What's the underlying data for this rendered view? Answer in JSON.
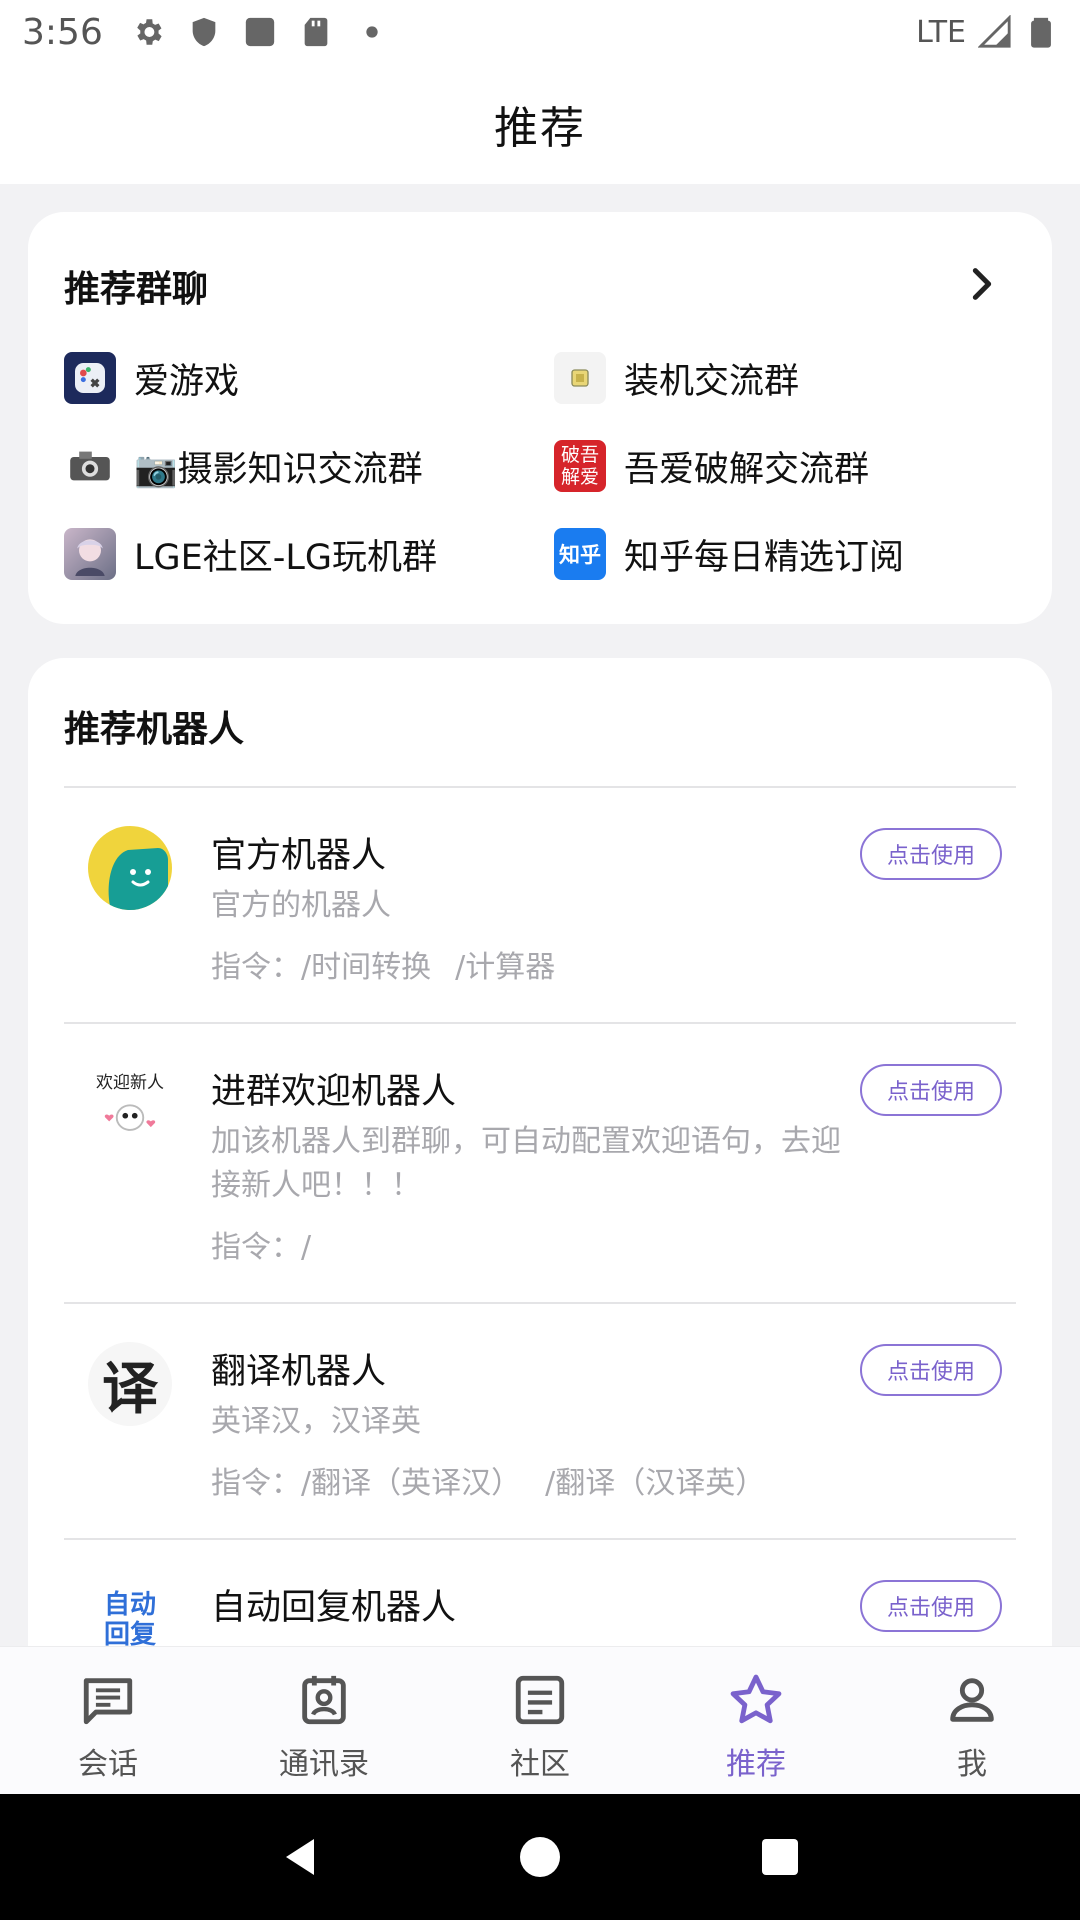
{
  "status_bar": {
    "time": "3:56",
    "network": "LTE",
    "left_icons": [
      "gear-icon",
      "shield-icon",
      "square-app-icon",
      "sd-card-icon",
      "dot-icon"
    ],
    "right_icons": [
      "signal-icon",
      "battery-icon"
    ]
  },
  "header": {
    "title": "推荐"
  },
  "groups": {
    "title": "推荐群聊",
    "items": [
      {
        "name": "爱游戏",
        "avatar": "gamepad-avatar"
      },
      {
        "name": "装机交流群",
        "avatar": "cpu-chip-avatar"
      },
      {
        "name": "📷摄影知识交流群",
        "avatar": "camera-avatar"
      },
      {
        "name": "吾爱破解交流群",
        "avatar": "seal-avatar",
        "avatar_text": "破吾解爱"
      },
      {
        "name": "LGE社区-LG玩机群",
        "avatar": "anime-avatar"
      },
      {
        "name": "知乎每日精选订阅",
        "avatar": "zhihu-avatar",
        "avatar_text": "知乎"
      }
    ]
  },
  "bots": {
    "title": "推荐机器人",
    "use_label": "点击使用",
    "items": [
      {
        "name": "官方机器人",
        "desc": "官方的机器人",
        "commands_label": "指令：",
        "commands": [
          "/时间转换",
          "/计算器"
        ],
        "avatar": "smile-bot-avatar"
      },
      {
        "name": "进群欢迎机器人",
        "desc": "加该机器人到群聊，可自动配置欢迎语句，去迎接新人吧！！！",
        "commands_label": "指令：",
        "commands": [
          "/"
        ],
        "avatar": "welcome-bot-avatar",
        "avatar_text": "欢迎新人"
      },
      {
        "name": "翻译机器人",
        "desc": "英译汉，汉译英",
        "commands_label": "指令：",
        "commands": [
          "/翻译（英译汉）",
          "/翻译（汉译英）"
        ],
        "avatar": "translate-bot-avatar",
        "avatar_text": "译"
      },
      {
        "name": "自动回复机器人",
        "desc": "",
        "commands_label": "",
        "commands": [],
        "avatar": "auto-reply-bot-avatar",
        "avatar_text": "自动回复"
      }
    ]
  },
  "bottom_nav": {
    "active": "推荐",
    "items": [
      {
        "label": "会话",
        "icon": "chat-icon"
      },
      {
        "label": "通讯录",
        "icon": "contacts-icon"
      },
      {
        "label": "社区",
        "icon": "community-icon"
      },
      {
        "label": "推荐",
        "icon": "star-icon"
      },
      {
        "label": "我",
        "icon": "person-icon"
      }
    ]
  },
  "colors": {
    "accent": "#7a62cc",
    "muted_text": "#a8a8ad",
    "background": "#f2f2f4"
  }
}
